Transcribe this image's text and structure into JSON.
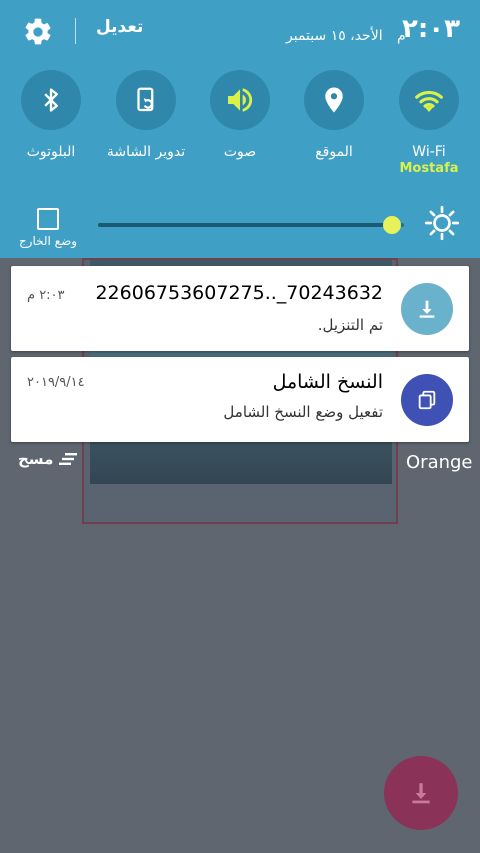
{
  "header": {
    "edit_label": "تعديل",
    "time": "٢:٠٣",
    "ampm": "م",
    "date": "الأحد، ١٥ سبتمبر"
  },
  "quick_settings": [
    {
      "id": "wifi",
      "label": "Wi-Fi",
      "sublabel": "Mostafa",
      "active": true
    },
    {
      "id": "location",
      "label": "الموقع",
      "active": false
    },
    {
      "id": "sound",
      "label": "صوت",
      "active": true
    },
    {
      "id": "rotate",
      "label": "تدوير الشاشة",
      "active": false
    },
    {
      "id": "bluetooth",
      "label": "البلوتوث",
      "active": false
    }
  ],
  "brightness": {
    "outdoor_label": "وضع الخارج",
    "level": 0.99
  },
  "notifications": [
    {
      "title": "22606753607275.._70243632",
      "body": "تم التنزيل.",
      "time": "٢:٠٣ م",
      "icon": "download-icon",
      "icon_color": "#6ab2cc"
    },
    {
      "title": "النسخ الشامل",
      "body": "تفعيل وضع النسخ الشامل",
      "time": "٢٠١٩/٩/١٤",
      "icon": "copy-icon",
      "icon_color": "#3f51b5"
    }
  ],
  "footer": {
    "clear_label": "مسح",
    "carrier": "Orange"
  },
  "colors": {
    "panel": "#3f9fc5",
    "accent": "#d9f24a",
    "fab": "#8a3258"
  }
}
